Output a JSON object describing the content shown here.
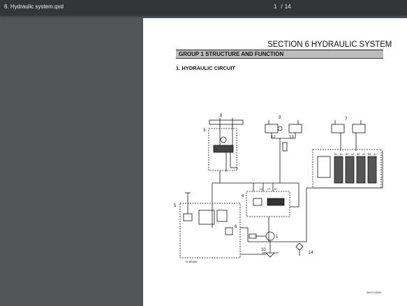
{
  "viewer": {
    "file_name": "6. Hydraulic system.qxd",
    "current_page": "1",
    "page_separator": "/",
    "total_pages": "14"
  },
  "document": {
    "section_title": "SECTION 6  HYDRAULIC SYSTEM",
    "group_title": "GROUP  1  STRUCTURE AND FUNCTION",
    "subsection_title": "1. HYDRAULIC CIRCUIT",
    "figure_code": "3507CH001"
  },
  "diagram": {
    "callouts": [
      "1",
      "3",
      "4",
      "5",
      "6",
      "7",
      "8",
      "9",
      "10",
      "12",
      "13",
      "14"
    ],
    "port_labels": [
      "LS",
      "CF",
      "EF",
      "B1",
      "A1",
      "B2",
      "A2",
      "B3",
      "A3",
      "B4",
      "A4"
    ],
    "brake_label": "TO BRAKE"
  }
}
